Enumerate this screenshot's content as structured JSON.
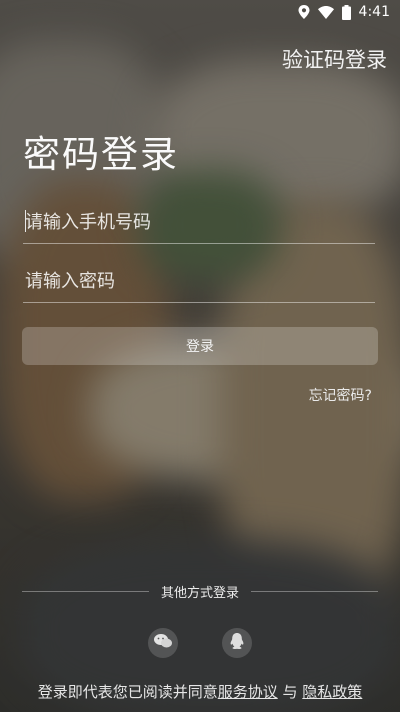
{
  "status_bar": {
    "time": "4:41",
    "icons": [
      "location-icon",
      "wifi-icon",
      "battery-icon"
    ]
  },
  "header": {
    "switch_mode_label": "验证码登录"
  },
  "page": {
    "title": "密码登录"
  },
  "form": {
    "phone": {
      "placeholder": "请输入手机号码",
      "value": ""
    },
    "password": {
      "placeholder": "请输入密码",
      "value": ""
    },
    "login_label": "登录",
    "forgot_label": "忘记密码?"
  },
  "other_login": {
    "label": "其他方式登录",
    "methods": [
      {
        "icon": "wechat-icon"
      },
      {
        "icon": "qq-icon"
      }
    ]
  },
  "agreement": {
    "prefix": "登录即代表您已阅读并同意",
    "service_terms": "服务协议",
    "conjunction": "与",
    "privacy_policy": "隐私政策"
  }
}
